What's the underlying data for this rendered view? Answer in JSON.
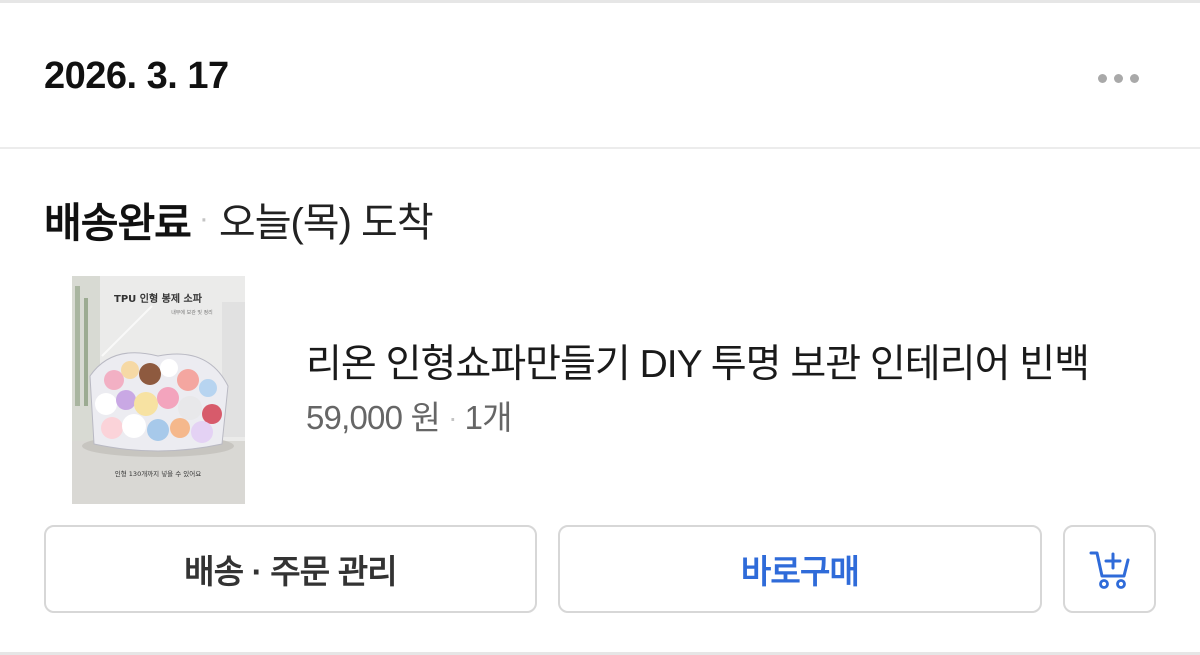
{
  "order": {
    "date": "2026. 3. 17",
    "more_icon": "more-horizontal-icon"
  },
  "status": {
    "main": "배송완료",
    "separator": "·",
    "sub": "오늘(목) 도착"
  },
  "product": {
    "name": "리온 인형쇼파만들기 DIY 투명 보관 인테리어 빈백",
    "price": "59,000 원",
    "separator": "·",
    "quantity": "1개",
    "thumbnail": {
      "title": "TPU 인형 봉제 소파",
      "subtitle": "내부에 보관 및 정리",
      "caption": "인형 130개까지 넣을 수 있어요"
    }
  },
  "actions": {
    "manage_label": "배송 · 주문 관리",
    "buy_label": "바로구매",
    "cart_icon": "cart-add-icon"
  },
  "colors": {
    "accent": "#2f6bd9",
    "border": "#d7d7d7",
    "muted_text": "#666666"
  }
}
